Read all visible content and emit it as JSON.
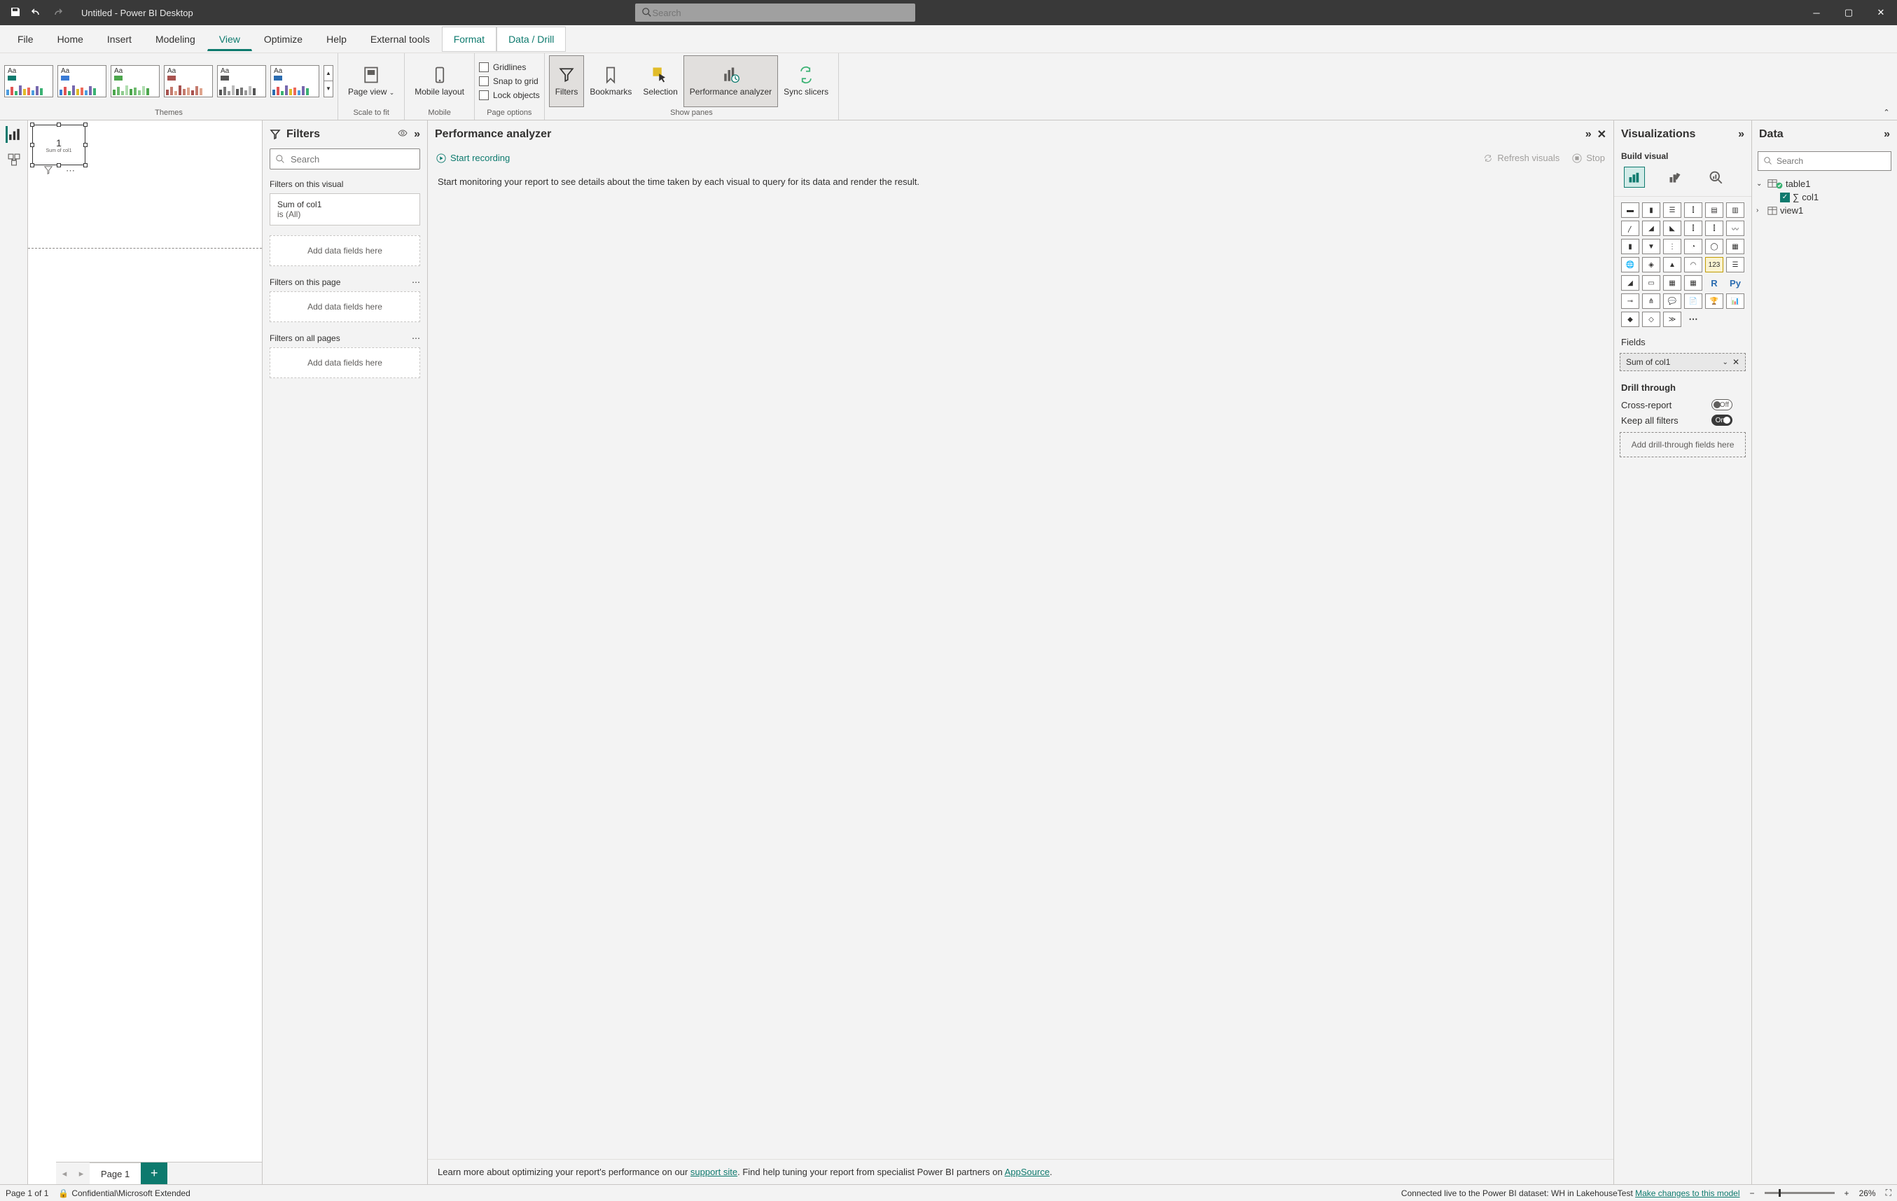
{
  "title": "Untitled - Power BI Desktop",
  "search_placeholder": "Search",
  "menu_tabs": [
    "File",
    "Home",
    "Insert",
    "Modeling",
    "View",
    "Optimize",
    "Help",
    "External tools",
    "Format",
    "Data / Drill"
  ],
  "ribbon": {
    "themes_label": "Themes",
    "scale_label": "Scale to fit",
    "page_view": "Page view",
    "mobile_label": "Mobile",
    "mobile_layout": "Mobile layout",
    "page_options_label": "Page options",
    "gridlines": "Gridlines",
    "snap": "Snap to grid",
    "lock": "Lock objects",
    "show_panes_label": "Show panes",
    "filters": "Filters",
    "bookmarks": "Bookmarks",
    "selection": "Selection",
    "perf": "Performance analyzer",
    "sync": "Sync slicers"
  },
  "canvas": {
    "value": "1",
    "caption": "Sum of col1"
  },
  "filters": {
    "title": "Filters",
    "search_placeholder": "Search",
    "on_visual": "Filters on this visual",
    "card_title": "Sum of col1",
    "card_sub": "is (All)",
    "add_here": "Add data fields here",
    "on_page": "Filters on this page",
    "on_all": "Filters on all pages"
  },
  "perf": {
    "title": "Performance analyzer",
    "start": "Start recording",
    "refresh": "Refresh visuals",
    "stop": "Stop",
    "msg": "Start monitoring your report to see details about the time taken by each visual to query for its data and render the result.",
    "footer1": "Learn more about optimizing your report's performance on our ",
    "support": "support site",
    "footer2": ". Find help tuning your report from specialist Power BI partners on ",
    "appsource": "AppSource",
    "footer3": "."
  },
  "viz": {
    "title": "Visualizations",
    "build": "Build visual",
    "fields": "Fields",
    "field_item": "Sum of col1",
    "drill": "Drill through",
    "cross": "Cross-report",
    "cross_state": "Off",
    "keep": "Keep all filters",
    "keep_state": "On",
    "drill_drop": "Add drill-through fields here"
  },
  "data": {
    "title": "Data",
    "search_placeholder": "Search",
    "table": "table1",
    "col": "col1",
    "view": "view1"
  },
  "page_tab": "Page 1",
  "status": {
    "page": "Page 1 of 1",
    "classification": "Confidential\\Microsoft Extended",
    "connection": "Connected live to the Power BI dataset: WH in LakehouseTest ",
    "changes": "Make changes to this model",
    "zoom": "26%"
  }
}
